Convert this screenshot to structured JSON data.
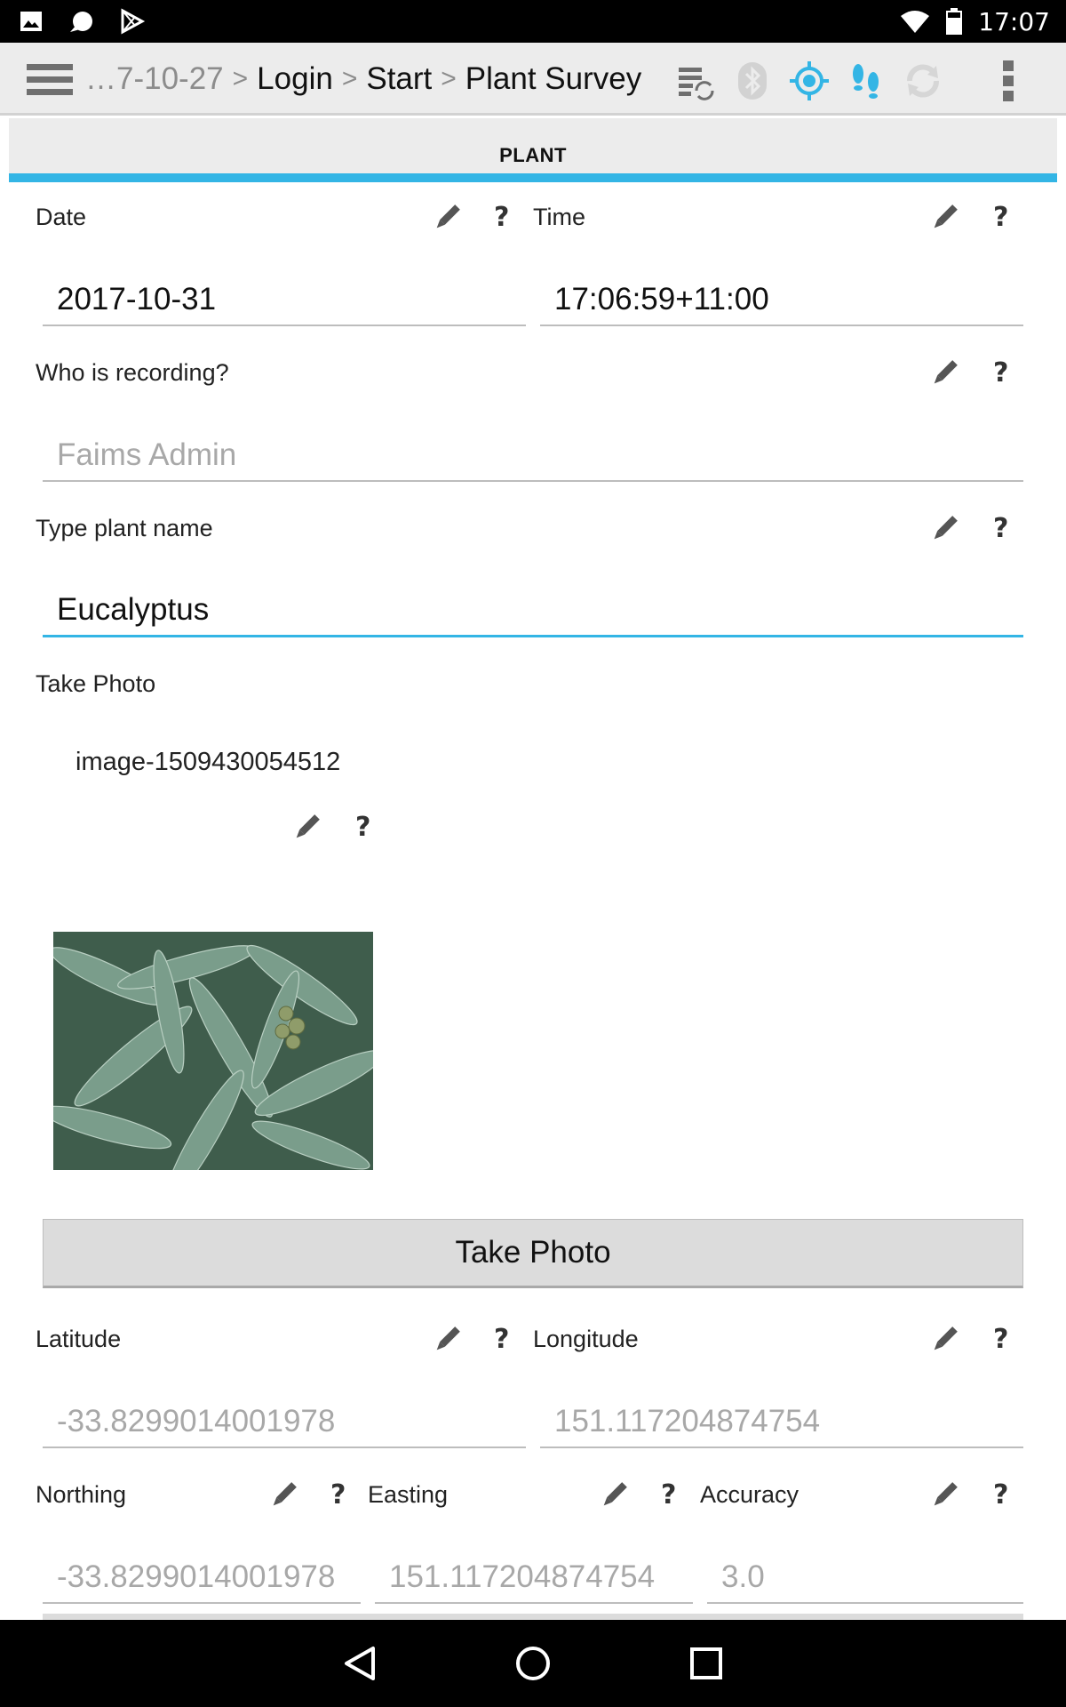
{
  "status_bar": {
    "time": "17:07",
    "left_icons": [
      "image-icon",
      "chat-bubble-icon",
      "play-store-icon"
    ],
    "right_icons": [
      "wifi-icon",
      "battery-icon"
    ]
  },
  "action_bar": {
    "breadcrumb_truncated": "…7-10-27",
    "separator": ">",
    "crumbs": [
      "Login",
      "Start",
      "Plant Survey"
    ],
    "icons": [
      "sync-list-icon",
      "bluetooth-icon",
      "gps-icon",
      "tracking-footsteps-icon",
      "refresh-icon",
      "overflow-menu-icon"
    ],
    "accent": "#33b5e5"
  },
  "tab": {
    "label": "PLANT"
  },
  "form": {
    "date": {
      "label": "Date",
      "value": "2017-10-31"
    },
    "time": {
      "label": "Time",
      "value": "17:06:59+11:00"
    },
    "recorder": {
      "label": "Who is recording?",
      "value": "Faims Admin"
    },
    "plant_name": {
      "label": "Type plant name",
      "value": "Eucalyptus"
    },
    "photo": {
      "label": "Take Photo",
      "file_name": "image-1509430054512",
      "button_label": "Take Photo"
    },
    "latitude": {
      "label": "Latitude",
      "value": "-33.8299014001978"
    },
    "longitude": {
      "label": "Longitude",
      "value": "151.117204874754"
    },
    "northing": {
      "label": "Northing",
      "value": "-33.8299014001978"
    },
    "easting": {
      "label": "Easting",
      "value": "151.117204874754"
    },
    "accuracy": {
      "label": "Accuracy",
      "value": "3.0"
    },
    "help_glyph": "?"
  },
  "nav_bar": {
    "buttons": [
      "back-icon",
      "home-icon",
      "recents-icon"
    ]
  }
}
